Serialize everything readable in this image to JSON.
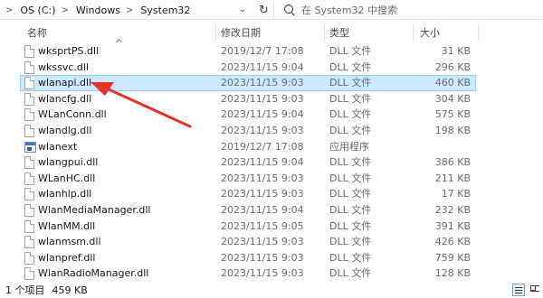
{
  "address": {
    "crumbs": [
      "OS (C:)",
      "Windows",
      "System32"
    ],
    "separator": ">"
  },
  "search": {
    "placeholder": "在 System32 中搜索"
  },
  "columns": {
    "name": "名称",
    "date": "修改日期",
    "type": "类型",
    "size": "大小"
  },
  "files": [
    {
      "name": "wksprtPS.dll",
      "date": "2019/12/7 17:08",
      "type": "DLL 文件",
      "size": "31 KB",
      "icon": "dll-file-icon"
    },
    {
      "name": "wkssvc.dll",
      "date": "2023/11/15 9:04",
      "type": "DLL 文件",
      "size": "296 KB",
      "icon": "dll-file-icon"
    },
    {
      "name": "wlanapi.dll",
      "date": "2023/11/15 9:03",
      "type": "DLL 文件",
      "size": "460 KB",
      "icon": "dll-file-icon",
      "selected": true
    },
    {
      "name": "wlancfg.dll",
      "date": "2023/11/15 9:03",
      "type": "DLL 文件",
      "size": "304 KB",
      "icon": "dll-file-icon"
    },
    {
      "name": "WLanConn.dll",
      "date": "2023/11/15 9:04",
      "type": "DLL 文件",
      "size": "575 KB",
      "icon": "dll-file-icon"
    },
    {
      "name": "wlandlg.dll",
      "date": "2023/11/15 9:03",
      "type": "DLL 文件",
      "size": "198 KB",
      "icon": "dll-file-icon"
    },
    {
      "name": "wlanext",
      "date": "2019/12/7 17:08",
      "type": "应用程序",
      "size": "",
      "icon": "application-icon"
    },
    {
      "name": "wlangpui.dll",
      "date": "2023/11/15 9:04",
      "type": "DLL 文件",
      "size": "386 KB",
      "icon": "dll-file-icon"
    },
    {
      "name": "WLanHC.dll",
      "date": "2023/11/15 9:03",
      "type": "DLL 文件",
      "size": "211 KB",
      "icon": "dll-file-icon"
    },
    {
      "name": "wlanhlp.dll",
      "date": "2023/11/15 9:03",
      "type": "DLL 文件",
      "size": "17 KB",
      "icon": "dll-file-icon"
    },
    {
      "name": "WlanMediaManager.dll",
      "date": "2023/11/15 9:04",
      "type": "DLL 文件",
      "size": "232 KB",
      "icon": "dll-file-icon"
    },
    {
      "name": "WlanMM.dll",
      "date": "2023/11/15 9:05",
      "type": "DLL 文件",
      "size": "391 KB",
      "icon": "dll-file-icon"
    },
    {
      "name": "wlanmsm.dll",
      "date": "2023/11/15 9:03",
      "type": "DLL 文件",
      "size": "426 KB",
      "icon": "dll-file-icon"
    },
    {
      "name": "wlanpref.dll",
      "date": "2023/11/15 9:03",
      "type": "DLL 文件",
      "size": "759 KB",
      "icon": "dll-file-icon"
    },
    {
      "name": "WlanRadioManager.dll",
      "date": "2023/11/15 9:03",
      "type": "DLL 文件",
      "size": "128 KB",
      "icon": "dll-file-icon"
    }
  ],
  "status": {
    "count": "1 个项目",
    "selected_size": "459 KB"
  },
  "annotation": {
    "arrow_color": "#e8312a"
  },
  "colors": {
    "selection_bg": "#cce8ff",
    "selection_border": "#99d1ff"
  }
}
